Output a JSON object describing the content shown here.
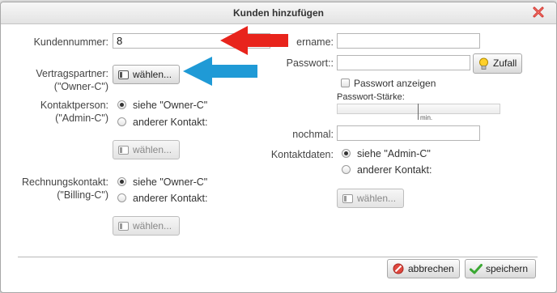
{
  "dialog": {
    "title": "Kunden hinzufügen",
    "close_icon": "close-x-icon"
  },
  "left": {
    "customer_number": {
      "label": "Kundennummer:",
      "value": "8"
    },
    "contract_partner": {
      "label_line1": "Vertragspartner:",
      "label_line2": "(\"Owner-C\")",
      "button": "wählen..."
    },
    "contact_person": {
      "label_line1": "Kontaktperson:",
      "label_line2": "(\"Admin-C\")",
      "option1": "siehe \"Owner-C\"",
      "option2": "anderer Kontakt:",
      "selected": "option1",
      "button": "wählen..."
    },
    "billing_contact": {
      "label_line1": "Rechnungskontakt:",
      "label_line2": "(\"Billing-C\")",
      "option1": "siehe \"Owner-C\"",
      "option2": "anderer Kontakt:",
      "selected": "option1",
      "button": "wählen..."
    }
  },
  "right": {
    "username": {
      "label": "ername:",
      "value": ""
    },
    "password": {
      "label": "Passwort::",
      "value": "",
      "random_button": "Zufall"
    },
    "show_password": {
      "label": "Passwort anzeigen",
      "checked": false
    },
    "strength": {
      "label": "Passwort-Stärke:",
      "min_label": "min."
    },
    "repeat": {
      "label": "nochmal:",
      "value": ""
    },
    "contact_data": {
      "label": "Kontaktdaten:",
      "option1": "siehe \"Admin-C\"",
      "option2": "anderer Kontakt:",
      "selected": "option1",
      "button": "wählen..."
    }
  },
  "footer": {
    "cancel": "abbrechen",
    "save": "speichern"
  },
  "annotations": {
    "red_arrow_color": "#e8241c",
    "blue_arrow_color": "#1f9ad6"
  }
}
